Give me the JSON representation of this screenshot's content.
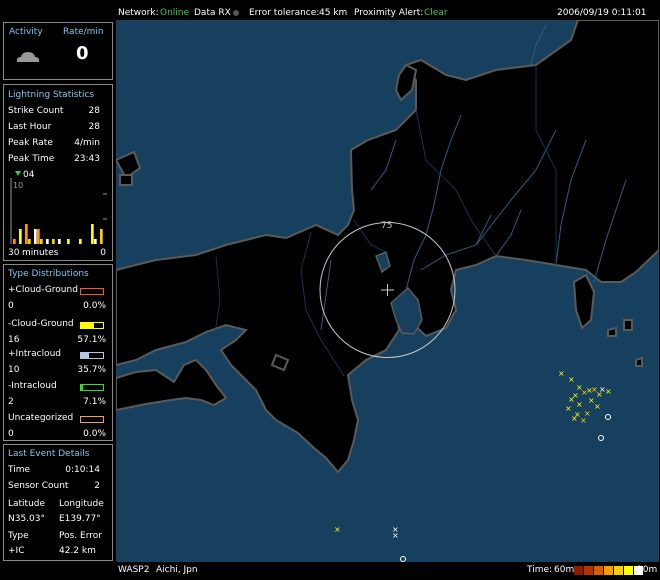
{
  "top": {
    "network_label": "Network:",
    "network_status": "Online",
    "data_rx": "Data RX",
    "error_tolerance_label": "Error tolerance:",
    "error_tolerance_value": "45 km",
    "proximity_label": "Proximity Alert:",
    "proximity_status": "Clear",
    "datetime": "2006/09/19 0:11:01"
  },
  "activity": {
    "title": "Activity",
    "rate_label": "Rate/min",
    "rate_value": "0",
    "icon": "cloud-icon"
  },
  "lightning_stats": {
    "title": "Lightning Statistics",
    "rows": [
      {
        "label": "Strike Count",
        "value": "28"
      },
      {
        "label": "Last Hour",
        "value": "28"
      },
      {
        "label": "Peak Rate",
        "value": "4/min"
      },
      {
        "label": "Peak Time",
        "value": "23:43"
      }
    ],
    "hist_marker": "04",
    "hist_ymax": "10",
    "hist_xleft": "30",
    "hist_xunit": "minutes",
    "hist_xright": "0"
  },
  "chart_data": {
    "type": "bar",
    "xlabel": "minutes",
    "x_range": [
      30,
      0
    ],
    "ylim": [
      0,
      10
    ],
    "values_per_minute": [
      1,
      0,
      3,
      0,
      4,
      1,
      0,
      3,
      3,
      1,
      0,
      1,
      0,
      1,
      0,
      1,
      0,
      0,
      1,
      0,
      0,
      0,
      1,
      0,
      0,
      0,
      4,
      1,
      0,
      3
    ],
    "colors_by_age": [
      "#ff9900",
      "#ffcc00",
      "#ffff00",
      "#ffffff"
    ]
  },
  "type_distributions": {
    "title": "Type Distributions",
    "items": [
      {
        "label": "+Cloud-Ground",
        "count": "0",
        "pct": "0.0%",
        "color": "#ff5a1e",
        "fill": 0.0
      },
      {
        "label": "-Cloud-Ground",
        "count": "16",
        "pct": "57.1%",
        "color": "#ffff00",
        "fill": 0.571
      },
      {
        "label": "+Intracloud",
        "count": "10",
        "pct": "35.7%",
        "color": "#b4c8e6",
        "fill": 0.357
      },
      {
        "label": "-Intracloud",
        "count": "2",
        "pct": "7.1%",
        "color": "#32dc32",
        "fill": 0.071
      },
      {
        "label": "Uncategorized",
        "count": "0",
        "pct": "0.0%",
        "color": "#f0a050",
        "fill": 0.0
      }
    ]
  },
  "last_event": {
    "title": "Last Event Details",
    "time_label": "Time",
    "time_value": "0:10:14",
    "sensor_label": "Sensor Count",
    "sensor_value": "2",
    "lat_label": "Latitude",
    "lat_value": "N35.03°",
    "lon_label": "Longitude",
    "lon_value": "E139.77°",
    "type_label": "Type",
    "type_value": "+IC",
    "pos_error_label": "Pos. Error",
    "pos_error_value": "42.2 km"
  },
  "map": {
    "ring_label": "75",
    "colors": {
      "sea": "#16405e",
      "land": "#000000",
      "coast": "#5a5a5a",
      "river": "#2a5e82",
      "ring": "#c8c8c8"
    }
  },
  "bottom": {
    "station": "WASP2",
    "location": "Aichi, Jpn",
    "time_label": "Time:",
    "time_start": "60m",
    "time_end": "10m",
    "legend_colors": [
      "#8b1a00",
      "#b83200",
      "#e05a00",
      "#ff9900",
      "#ffcc00",
      "#ffff00",
      "#ffffff"
    ]
  }
}
